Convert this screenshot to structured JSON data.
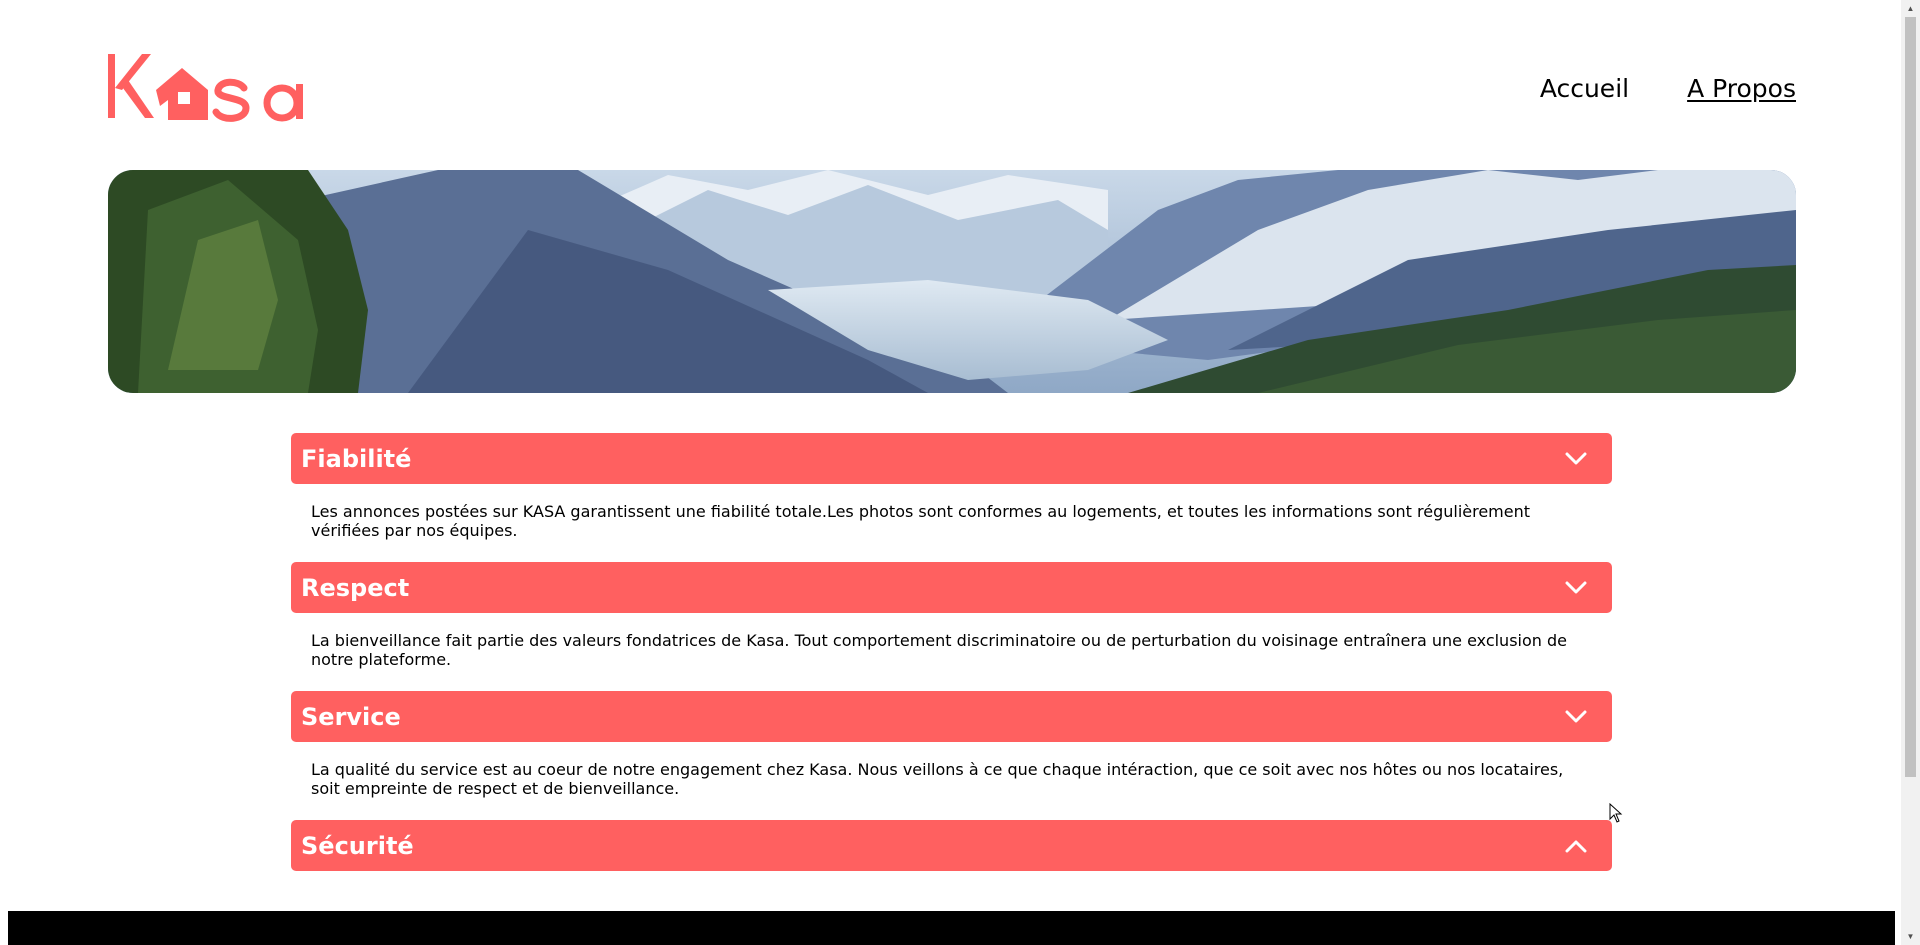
{
  "header": {
    "logo_text": "Kasa",
    "nav": [
      {
        "label": "Accueil",
        "active": false
      },
      {
        "label": "A Propos",
        "active": true
      }
    ]
  },
  "collapses": [
    {
      "title": "Fiabilité",
      "open": true,
      "text": "Les annonces postées sur KASA garantissent une fiabilité totale.Les photos sont conformes au logements, et toutes les informations sont régulièrement vérifiées par nos équipes."
    },
    {
      "title": "Respect",
      "open": true,
      "text": "La bienveillance fait partie des valeurs fondatrices de Kasa. Tout comportement discriminatoire ou de perturbation du voisinage entraînera une exclusion de notre plateforme."
    },
    {
      "title": "Service",
      "open": true,
      "text": "La qualité du service est au coeur de notre engagement chez Kasa. Nous veillons à ce que chaque intéraction, que ce soit avec nos hôtes ou nos locataires, soit empreinte de respect et de bienveillance."
    },
    {
      "title": "Sécurité",
      "open": false,
      "text": ""
    }
  ],
  "colors": {
    "brand": "#ff6060",
    "footer": "#000000"
  },
  "icons": {
    "open": "chevron-down-icon",
    "closed": "chevron-up-icon"
  }
}
